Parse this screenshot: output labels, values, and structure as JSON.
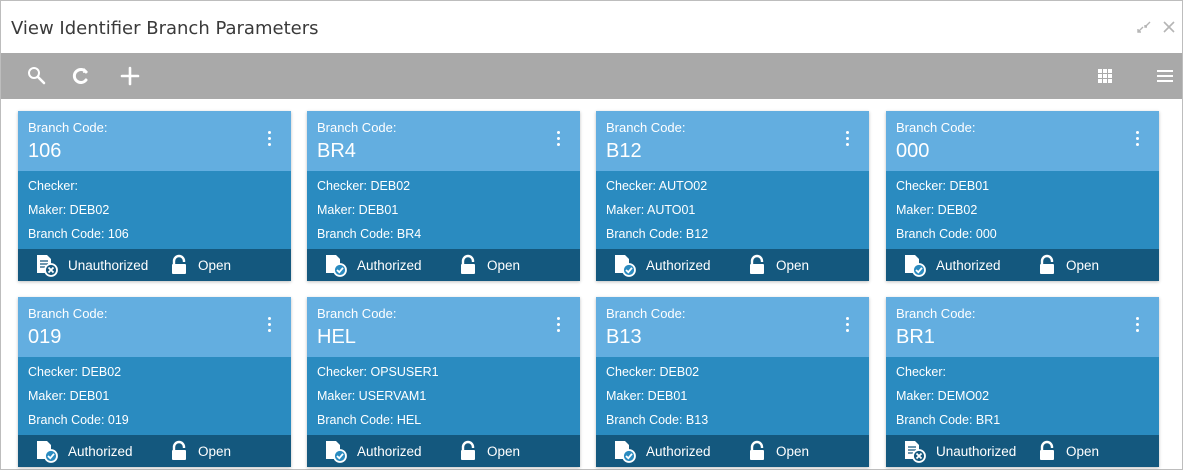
{
  "window": {
    "title": "View Identifier Branch Parameters",
    "controls": [
      "minimize-icon",
      "close-icon"
    ]
  },
  "toolbar": {
    "left": [
      "search-icon",
      "refresh-icon",
      "add-icon"
    ],
    "right": [
      "grid-view-icon",
      "list-view-icon"
    ]
  },
  "colors": {
    "toolbar": "#a9a9a9",
    "card_header": "#63aee0",
    "card_body": "#2a8bc0",
    "card_footer": "#14587e"
  },
  "cards": [
    {
      "header_label": "Branch Code:",
      "code": "106",
      "checker": "Checker:",
      "maker": "Maker: DEB02",
      "branch": "Branch Code: 106",
      "auth_status": "Unauthorized",
      "record_status": "Open"
    },
    {
      "header_label": "Branch Code:",
      "code": "BR4",
      "checker": "Checker: DEB02",
      "maker": "Maker: DEB01",
      "branch": "Branch Code: BR4",
      "auth_status": "Authorized",
      "record_status": "Open"
    },
    {
      "header_label": "Branch Code:",
      "code": "B12",
      "checker": "Checker: AUTO02",
      "maker": "Maker: AUTO01",
      "branch": "Branch Code: B12",
      "auth_status": "Authorized",
      "record_status": "Open"
    },
    {
      "header_label": "Branch Code:",
      "code": "000",
      "checker": "Checker: DEB01",
      "maker": "Maker: DEB02",
      "branch": "Branch Code: 000",
      "auth_status": "Authorized",
      "record_status": "Open"
    },
    {
      "header_label": "Branch Code:",
      "code": "019",
      "checker": "Checker: DEB02",
      "maker": "Maker: DEB01",
      "branch": "Branch Code: 019",
      "auth_status": "Authorized",
      "record_status": "Open"
    },
    {
      "header_label": "Branch Code:",
      "code": "HEL",
      "checker": "Checker: OPSUSER1",
      "maker": "Maker: USERVAM1",
      "branch": "Branch Code: HEL",
      "auth_status": "Authorized",
      "record_status": "Open"
    },
    {
      "header_label": "Branch Code:",
      "code": "B13",
      "checker": "Checker: DEB02",
      "maker": "Maker: DEB01",
      "branch": "Branch Code: B13",
      "auth_status": "Authorized",
      "record_status": "Open"
    },
    {
      "header_label": "Branch Code:",
      "code": "BR1",
      "checker": "Checker:",
      "maker": "Maker: DEMO02",
      "branch": "Branch Code: BR1",
      "auth_status": "Unauthorized",
      "record_status": "Open"
    }
  ]
}
